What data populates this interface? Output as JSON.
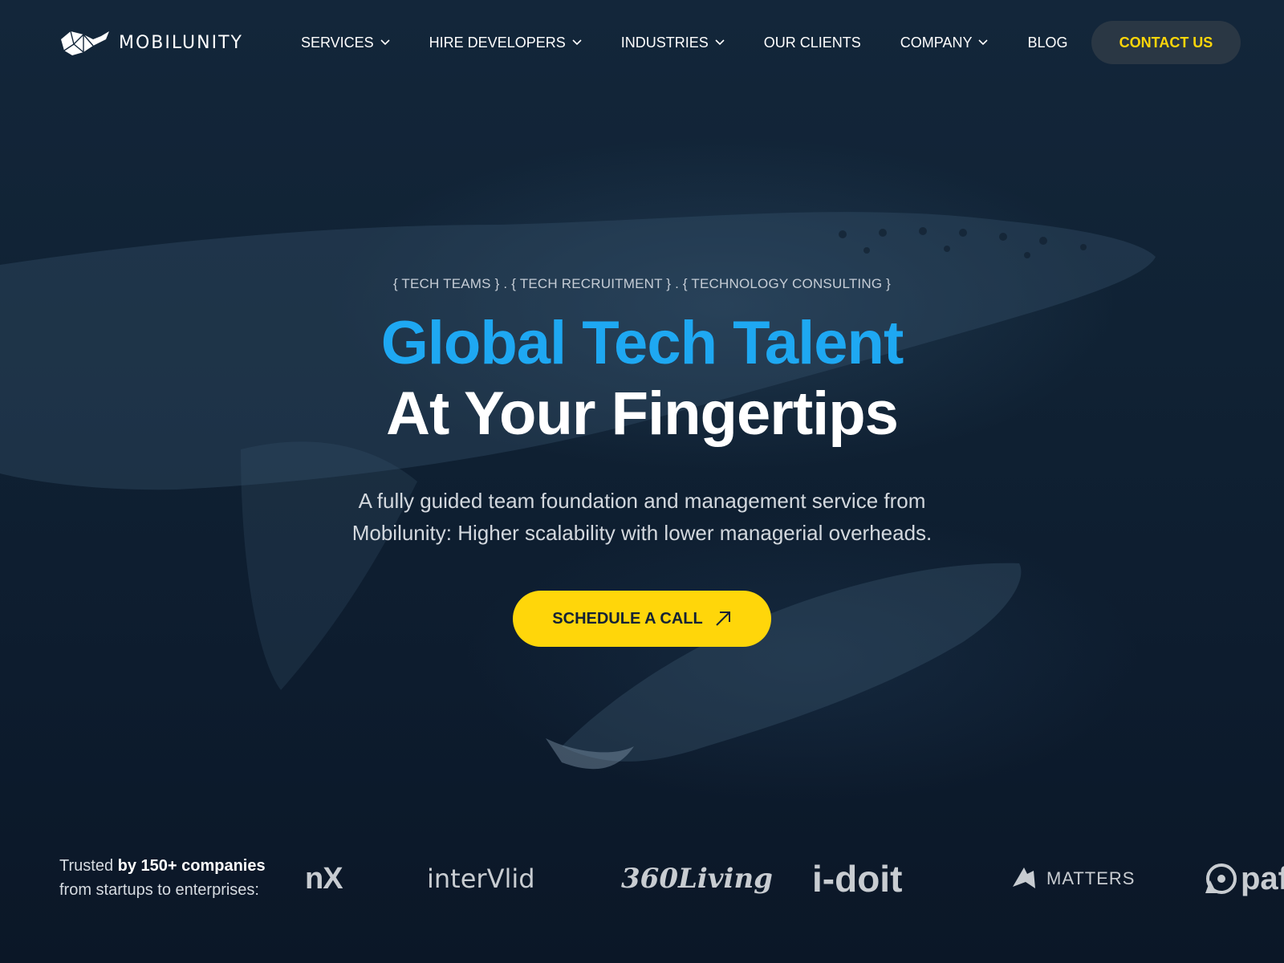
{
  "brand": {
    "name": "MOBILUNITY",
    "logo_icon": "whale-logo-icon"
  },
  "nav": {
    "items": [
      {
        "label": "SERVICES",
        "dropdown": true
      },
      {
        "label": "HIRE DEVELOPERS",
        "dropdown": true
      },
      {
        "label": "INDUSTRIES",
        "dropdown": true
      },
      {
        "label": "OUR CLIENTS",
        "dropdown": false
      },
      {
        "label": "COMPANY",
        "dropdown": true
      },
      {
        "label": "BLOG",
        "dropdown": false
      }
    ],
    "contact_label": "CONTACT US"
  },
  "hero": {
    "tagline": "{ TECH TEAMS } . { TECH RECRUITMENT } . { TECHNOLOGY CONSULTING }",
    "headline_line1": "Global Tech Talent",
    "headline_line2": "At Your Fingertips",
    "subtext": "A fully guided team foundation and management service from Mobilunity: Higher scalability with lower managerial overheads.",
    "cta_label": "SCHEDULE A CALL"
  },
  "trusted": {
    "prefix": "Trusted",
    "bold": "by 150+ companies",
    "line2": "from startups to enterprises:"
  },
  "client_logos": [
    {
      "name": "nX",
      "text": "nX"
    },
    {
      "name": "intervalid",
      "text": "interVlid"
    },
    {
      "name": "360living",
      "text": "360Living"
    },
    {
      "name": "i-doit",
      "text": "i-doit"
    },
    {
      "name": "matters",
      "text": "MATTERS"
    },
    {
      "name": "opal",
      "text": "paf"
    }
  ],
  "colors": {
    "accent_blue": "#1ea8f2",
    "accent_yellow": "#ffd60a",
    "background": "#0c1a2b",
    "contact_button_bg": "#2a3744"
  }
}
